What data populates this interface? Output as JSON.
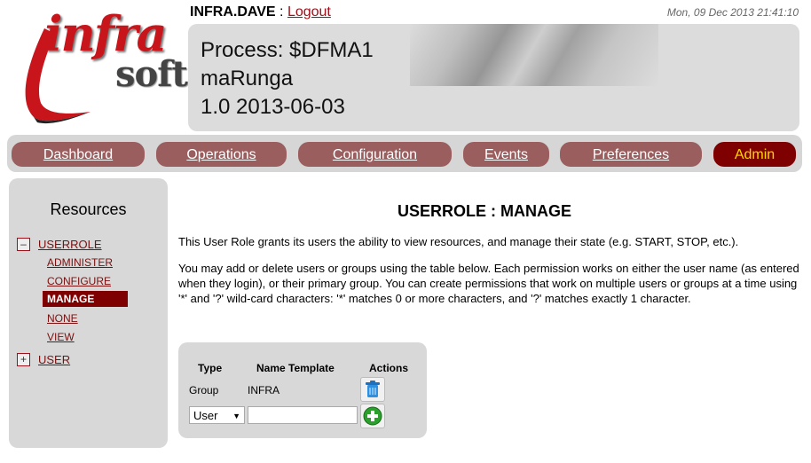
{
  "logo": {
    "infra": "infra",
    "soft": "soft"
  },
  "header": {
    "user": "INFRA.DAVE",
    "separator": " : ",
    "logout_label": "Logout",
    "timestamp": "Mon, 09 Dec 2013 21:41:10"
  },
  "process": {
    "line1": "Process: $DFMA1",
    "line2": "maRunga",
    "line3": "1.0 2013-06-03"
  },
  "nav": {
    "items": [
      {
        "label": "Dashboard"
      },
      {
        "label": "Operations"
      },
      {
        "label": "Configuration"
      },
      {
        "label": "Events"
      },
      {
        "label": "Preferences"
      },
      {
        "label": "Admin"
      }
    ],
    "active": "Admin"
  },
  "sidebar": {
    "title": "Resources",
    "tree": [
      {
        "toggle": "–",
        "label": "USERROLE",
        "children": [
          {
            "label": "ADMINISTER"
          },
          {
            "label": "CONFIGURE"
          },
          {
            "label": "MANAGE",
            "selected": true
          },
          {
            "label": "NONE"
          },
          {
            "label": "VIEW"
          }
        ]
      },
      {
        "toggle": "+",
        "label": "USER"
      }
    ]
  },
  "main": {
    "title": "USERROLE : MANAGE",
    "para1": "This User Role grants its users the ability to view resources, and manage their state (e.g. START, STOP, etc.).",
    "para2": "You may add or delete users or groups using the table below. Each permission works on either the user name (as entered when they login), or their primary group. You can create permissions that work on multiple users or groups at a time using '*' and '?' wild-card characters: '*' matches 0 or more characters, and '?' matches exactly 1 character."
  },
  "permissions": {
    "headers": [
      "Type",
      "Name Template",
      "Actions"
    ],
    "rows": [
      {
        "type": "Group",
        "name": "INFRA",
        "action_icon": "trash-icon"
      }
    ],
    "new_row": {
      "type_selected": "User",
      "name_value": "",
      "action_icon": "add-icon"
    }
  },
  "colors": {
    "nav_button": "#9a5e5e",
    "nav_active": "#7f0000",
    "nav_active_text": "#ffd700",
    "link": "#7a0f0f",
    "panel": "#d8d8d8"
  }
}
